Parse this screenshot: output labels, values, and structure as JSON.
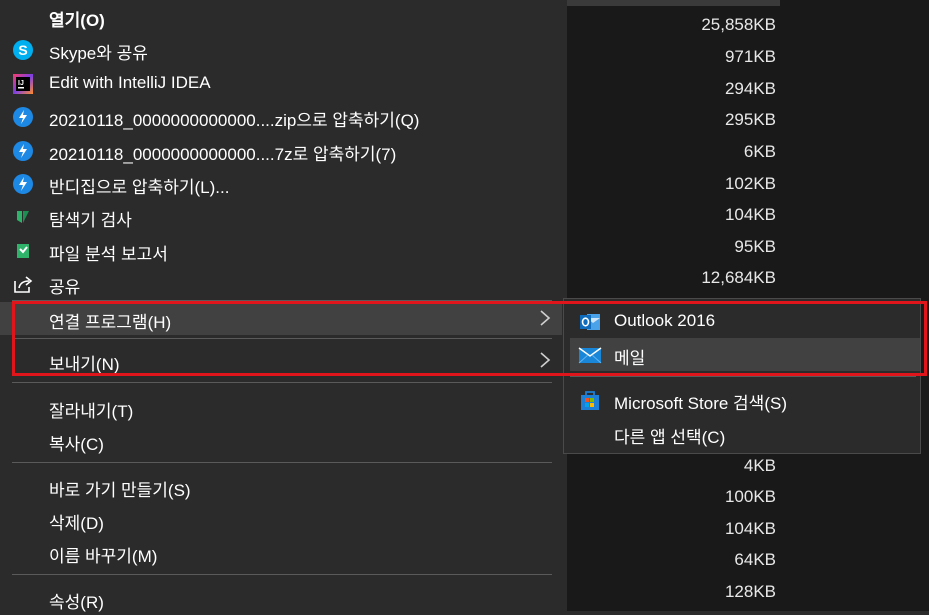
{
  "colors": {
    "menu_bg": "#2b2b2b",
    "list_bg": "#191919",
    "hover_bg": "#414141",
    "annotation_red": "#e0141b",
    "skype_blue": "#00aff0",
    "bandizip_blue": "#1e88e5",
    "defender_green": "#2fb36b"
  },
  "menu": {
    "items": [
      {
        "label": "열기(O)",
        "icon": ""
      },
      {
        "label": "Skype와 공유",
        "icon": "skype-icon"
      },
      {
        "label": "Edit with IntelliJ IDEA",
        "icon": "intellij-icon"
      },
      {
        "label": "20210118_0000000000000....zip으로 압축하기(Q)",
        "icon": "bandizip-icon"
      },
      {
        "label": "20210118_0000000000000....7z로 압축하기(7)",
        "icon": "bandizip-icon"
      },
      {
        "label": "반디집으로 압축하기(L)...",
        "icon": "bandizip-icon"
      },
      {
        "label": "탐색기 검사",
        "icon": "defender-icon"
      },
      {
        "label": "파일 분석 보고서",
        "icon": "report-icon"
      },
      {
        "label": "공유",
        "icon": "share-icon"
      },
      {
        "label": "연결 프로그램(H)",
        "icon": ""
      },
      {
        "label": "보내기(N)",
        "icon": ""
      },
      {
        "label": "잘라내기(T)",
        "icon": ""
      },
      {
        "label": "복사(C)",
        "icon": ""
      },
      {
        "label": "바로 가기 만들기(S)",
        "icon": ""
      },
      {
        "label": "삭제(D)",
        "icon": ""
      },
      {
        "label": "이름 바꾸기(M)",
        "icon": ""
      },
      {
        "label": "속성(R)",
        "icon": ""
      }
    ]
  },
  "submenu": {
    "items": [
      {
        "label": "Outlook 2016",
        "icon": "outlook-icon"
      },
      {
        "label": "메일",
        "icon": "mail-icon"
      },
      {
        "label": "Microsoft Store 검색(S)",
        "icon": "store-icon"
      },
      {
        "label": "다른 앱 선택(C)",
        "icon": ""
      }
    ]
  },
  "file_sizes": [
    "25,858KB",
    "971KB",
    "294KB",
    "295KB",
    "6KB",
    "102KB",
    "104KB",
    "95KB",
    "12,684KB",
    "4KB",
    "100KB",
    "104KB",
    "64KB",
    "128KB"
  ]
}
